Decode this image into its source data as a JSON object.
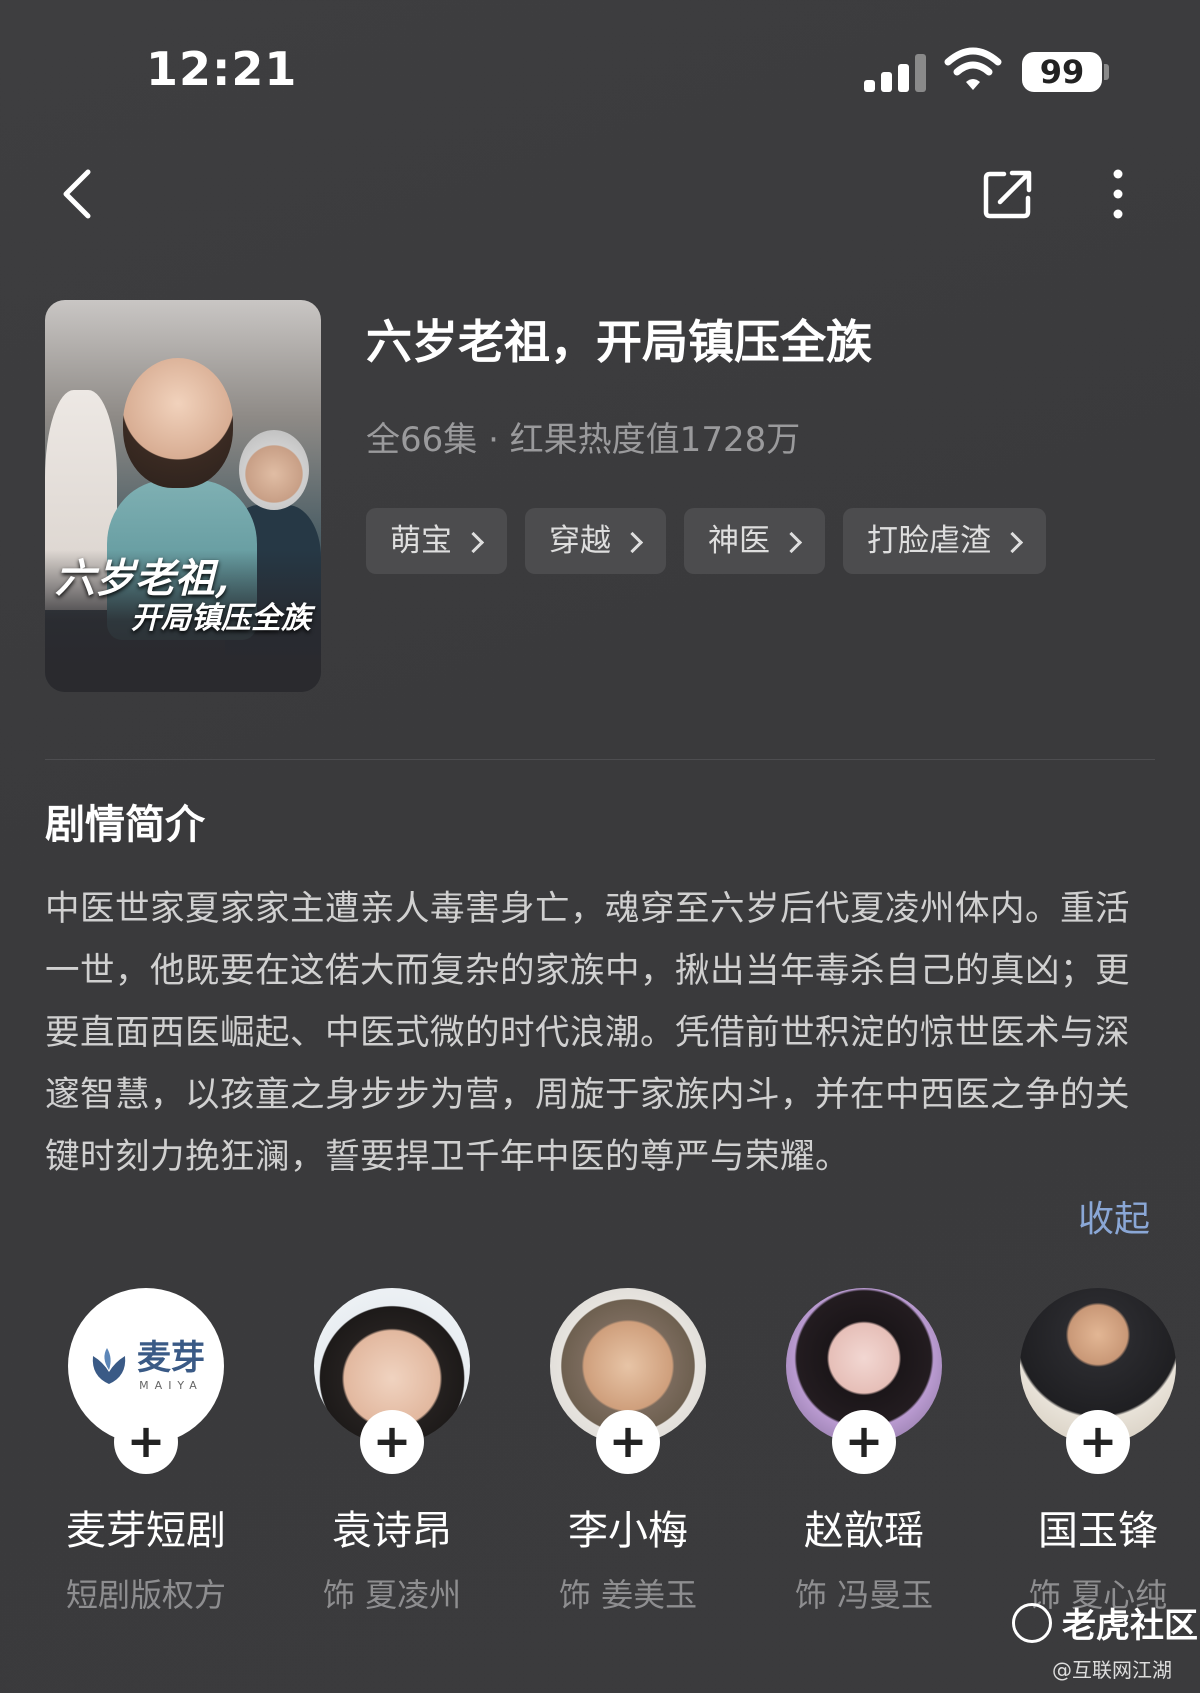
{
  "status_bar": {
    "time": "12:21",
    "battery": "99"
  },
  "poster": {
    "title_line1": "六岁老祖,",
    "title_line2": "开局镇压全族"
  },
  "drama": {
    "title": "六岁老祖，开局镇压全族",
    "meta": "全66集 · 红果热度值1728万",
    "tags": [
      "萌宝",
      "穿越",
      "神医",
      "打脸虐渣"
    ]
  },
  "synopsis": {
    "heading": "剧情简介",
    "text": "中医世家夏家家主遭亲人毒害身亡，魂穿至六岁后代夏凌州体内。重活一世，他既要在这偌大而复杂的家族中，揪出当年毒杀自己的真凶；更要直面西医崛起、中医式微的时代浪潮。凭借前世积淀的惊世医术与深邃智慧，以孩童之身步步为营，周旋于家族内斗，并在中西医之争的关键时刻力挽狂澜，誓要捍卫千年中医的尊严与荣耀。",
    "collapse": "收起"
  },
  "cast": [
    {
      "name": "麦芽短剧",
      "role": "短剧版权方",
      "avatar_text": "麦芽",
      "avatar_sub": "MAIYA"
    },
    {
      "name": "袁诗昂",
      "role": "饰 夏凌州"
    },
    {
      "name": "李小梅",
      "role": "饰 姜美玉"
    },
    {
      "name": "赵歆瑶",
      "role": "饰 冯曼玉"
    },
    {
      "name": "国玉锋",
      "role": "饰 夏心纯"
    }
  ],
  "watermark": {
    "text": "老虎社区",
    "credit": "@互联网江湖"
  }
}
